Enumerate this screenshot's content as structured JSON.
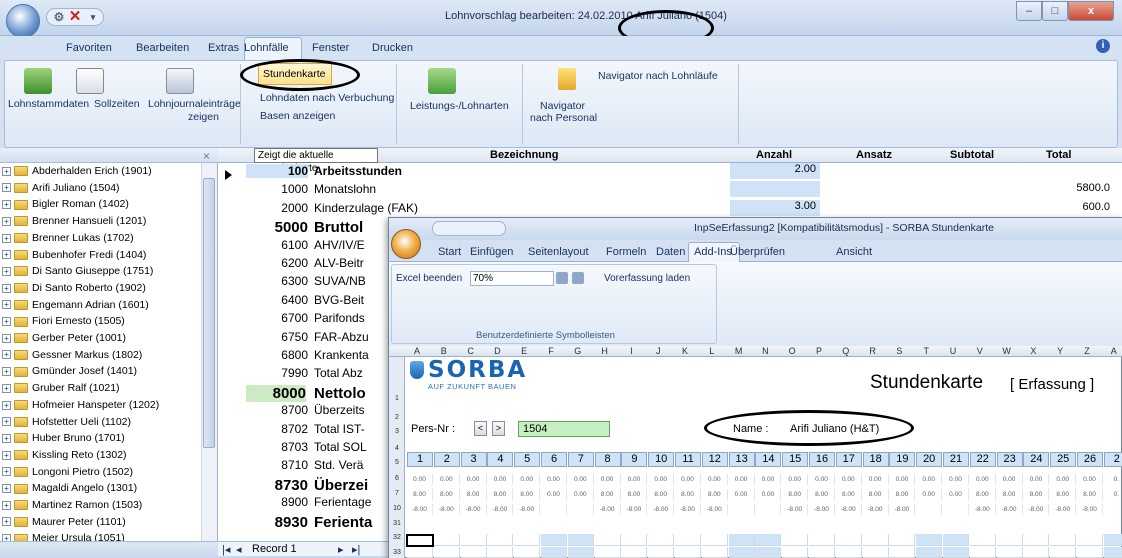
{
  "window": {
    "title": "Lohnvorschlag bearbeiten: 24.02.2010 Arifi Juliano (1504)",
    "controls": {
      "minimize": "–",
      "maximize": "□",
      "close": "x"
    }
  },
  "qat": {
    "gear": "⚙",
    "close": "✕",
    "drop": "▾"
  },
  "menu": [
    "Favoriten",
    "Bearbeiten",
    "Extras",
    "Lohnfälle",
    "Fenster",
    "Drucken"
  ],
  "help_label": "i",
  "ribbon": {
    "lohnstamm": "Lohnstammdaten",
    "sollzeiten": "Sollzeiten",
    "journal1": "Lohnjournaleinträge",
    "journal2": "zeigen",
    "stundenkarte": "Stundenkarte",
    "lohndaten": "Lohndaten nach Verbuchung",
    "basen": "Basen anzeigen",
    "leistungs": "Leistungs-/Lohnarten",
    "navlohn": "Navigator nach Lohnläufe",
    "navpers1": "Navigator",
    "navpers2": "nach Personal"
  },
  "tooltip": "Zeigt die aktuelle Stundenkarte",
  "panel_close": "×",
  "employees": [
    "Abderhalden Erich (1901)",
    "Arifi Juliano (1504)",
    "Bigler Roman (1402)",
    "Brenner Hansueli (1201)",
    "Brenner Lukas (1702)",
    "Bubenhofer Fredi (1404)",
    "Di Santo Giuseppe (1751)",
    "Di Santo Roberto (1902)",
    "Engemann Adrian (1601)",
    "Fiori Ernesto (1505)",
    "Gerber Peter (1001)",
    "Gessner Markus (1802)",
    "Gmünder Josef (1401)",
    "Gruber Ralf (1021)",
    "Hofmeier Hanspeter (1202)",
    "Hofstetter Ueli (1102)",
    "Huber Bruno (1701)",
    "Kissling Reto (1302)",
    "Longoni Pietro (1502)",
    "Magaldi Angelo (1301)",
    "Martinez Ramon (1503)",
    "Maurer Peter (1101)",
    "Meier Ursula (1051)"
  ],
  "grid": {
    "headers": {
      "bez": "Bezeichnung",
      "anzahl": "Anzahl",
      "ansatz": "Ansatz",
      "subtotal": "Subtotal",
      "total": "Total"
    },
    "rows": [
      {
        "code": "100",
        "name": "Arbeitsstunden",
        "anzahl": "2.00",
        "total": "",
        "big": false,
        "bold": true
      },
      {
        "code": "1000",
        "name": "Monatslohn",
        "anzahl": "",
        "total": "5800.0",
        "big": false,
        "bold": false
      },
      {
        "code": "2000",
        "name": "Kinderzulage (FAK)",
        "anzahl": "3.00",
        "total": "600.0",
        "big": false,
        "bold": false
      },
      {
        "code": "5000",
        "name": "Bruttol",
        "anzahl": "",
        "total": "",
        "big": true,
        "bold": true
      },
      {
        "code": "6100",
        "name": "AHV/IV/E",
        "anzahl": "",
        "total": "",
        "big": false,
        "bold": false
      },
      {
        "code": "6200",
        "name": "ALV-Beitr",
        "anzahl": "",
        "total": "",
        "big": false,
        "bold": false
      },
      {
        "code": "6300",
        "name": "SUVA/NB",
        "anzahl": "",
        "total": "",
        "big": false,
        "bold": false
      },
      {
        "code": "6400",
        "name": "BVG-Beit",
        "anzahl": "",
        "total": "",
        "big": false,
        "bold": false
      },
      {
        "code": "6700",
        "name": "Parifonds",
        "anzahl": "",
        "total": "",
        "big": false,
        "bold": false
      },
      {
        "code": "6750",
        "name": "FAR-Abzu",
        "anzahl": "",
        "total": "",
        "big": false,
        "bold": false
      },
      {
        "code": "6800",
        "name": "Krankenta",
        "anzahl": "",
        "total": "",
        "big": false,
        "bold": false
      },
      {
        "code": "7990",
        "name": "Total Abz",
        "anzahl": "",
        "total": "",
        "big": false,
        "bold": false
      },
      {
        "code": "8000",
        "name": "Nettolo",
        "anzahl": "",
        "total": "",
        "big": true,
        "bold": true
      },
      {
        "code": "8700",
        "name": "Überzeits",
        "anzahl": "",
        "total": "",
        "big": false,
        "bold": false
      },
      {
        "code": "8702",
        "name": "Total IST-",
        "anzahl": "",
        "total": "",
        "big": false,
        "bold": false
      },
      {
        "code": "8703",
        "name": "Total SOL",
        "anzahl": "",
        "total": "",
        "big": false,
        "bold": false
      },
      {
        "code": "8710",
        "name": "Std. Verä",
        "anzahl": "",
        "total": "",
        "big": false,
        "bold": false
      },
      {
        "code": "8730",
        "name": "Überzei",
        "anzahl": "",
        "total": "",
        "big": true,
        "bold": true
      },
      {
        "code": "8900",
        "name": "Ferientage",
        "anzahl": "",
        "total": "",
        "big": false,
        "bold": false
      },
      {
        "code": "8930",
        "name": "Ferienta",
        "anzahl": "",
        "total": "",
        "big": true,
        "bold": true
      }
    ]
  },
  "record_nav": {
    "first": "|◂",
    "prev": "◂",
    "label": "Record 1",
    "next": "▸",
    "last": "▸|"
  },
  "excel": {
    "title": "InpSeErfassung2 [Kompatibilitätsmodus] - SORBA Stundenkarte",
    "tabs": [
      "Start",
      "Einfügen",
      "Seitenlayout",
      "Formeln",
      "Daten",
      "Überprüfen",
      "Ansicht",
      "Add-Ins"
    ],
    "excel_beenden": "Excel beenden",
    "zoom": "70%",
    "vorerfassung": "Vorerfassung laden",
    "group_label": "Benutzerdefinierte Symbolleisten",
    "columns": [
      "A",
      "B",
      "C",
      "D",
      "E",
      "F",
      "G",
      "H",
      "I",
      "J",
      "K",
      "L",
      "M",
      "N",
      "O",
      "P",
      "Q",
      "R",
      "S",
      "T",
      "U",
      "V",
      "W",
      "X",
      "Y",
      "Z",
      "A"
    ],
    "rownums": [
      "1",
      "2",
      "3",
      "4",
      "5",
      "6",
      "7",
      "10",
      "31",
      "32",
      "33"
    ],
    "logo": "SORBA",
    "logo_sub": "AUF ZUKUNFT BAUEN",
    "sheet_title": "Stundenkarte",
    "sheet_sub": "[ Erfassung ]",
    "pers_label": "Pers-Nr :",
    "pers_prev": "<",
    "pers_next": ">",
    "pers_value": "1504",
    "name_label": "Name :",
    "name_value": "Arifi Juliano (H&T)",
    "days": [
      "1",
      "2",
      "3",
      "4",
      "5",
      "6",
      "7",
      "8",
      "9",
      "10",
      "11",
      "12",
      "13",
      "14",
      "15",
      "16",
      "17",
      "18",
      "19",
      "20",
      "21",
      "22",
      "23",
      "24",
      "25",
      "26",
      "2"
    ],
    "row6": [
      "0.00",
      "0.00",
      "0.00",
      "0.00",
      "0.00",
      "0.00",
      "0.00",
      "0.00",
      "0.00",
      "0.00",
      "0.00",
      "0.00",
      "0.00",
      "0.00",
      "0.00",
      "0.00",
      "0.00",
      "0.00",
      "0.00",
      "0.00",
      "0.00",
      "0.00",
      "0.00",
      "0.00",
      "0.00",
      "0.00",
      "0."
    ],
    "row7": [
      "8.00",
      "8.00",
      "8.00",
      "8.00",
      "8.00",
      "0.00",
      "0.00",
      "8.00",
      "8.00",
      "8.00",
      "8.00",
      "8.00",
      "0.00",
      "0.00",
      "8.00",
      "8.00",
      "8.00",
      "8.00",
      "8.00",
      "0.00",
      "0.00",
      "8.00",
      "8.00",
      "8.00",
      "8.00",
      "8.00",
      "0."
    ],
    "row10": [
      "-8.00",
      "-8.00",
      "-8.00",
      "-8.00",
      "-8.00",
      "",
      "",
      "-8.00",
      "-8.00",
      "-8.00",
      "-8.00",
      "-8.00",
      "",
      "",
      "-8.00",
      "-8.00",
      "-8.00",
      "-8.00",
      "-8.00",
      "",
      "",
      "-8.00",
      "-8.00",
      "-8.00",
      "-8.00",
      "-8.00",
      ""
    ]
  }
}
